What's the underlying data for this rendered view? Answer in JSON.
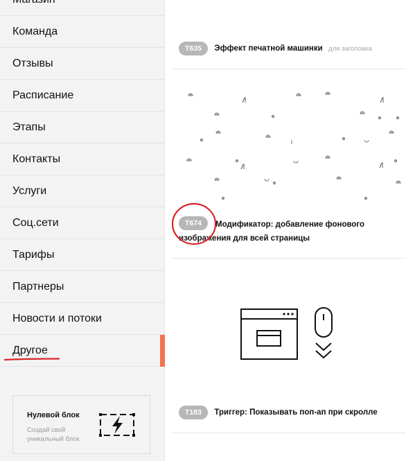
{
  "sidebar": {
    "top_partial_label": "Магазин",
    "items": [
      {
        "label": "Команда"
      },
      {
        "label": "Отзывы"
      },
      {
        "label": "Расписание"
      },
      {
        "label": "Этапы"
      },
      {
        "label": "Контакты"
      },
      {
        "label": "Услуги"
      },
      {
        "label": "Соц.сети"
      },
      {
        "label": "Тарифы"
      },
      {
        "label": "Партнеры"
      },
      {
        "label": "Новости и потоки"
      },
      {
        "label": "Другое",
        "active": true
      }
    ],
    "active_color": "#f4714e",
    "annotation_color": "#d9262a",
    "zero_block": {
      "title": "Нулевой блок",
      "subtitle": "Создай свой уникальный блок",
      "icon": "lightning-frame-icon"
    }
  },
  "cards": [
    {
      "code": "T635",
      "title": "Эффект печатной машинки",
      "hint": "для заголовка"
    },
    {
      "code": "T674",
      "title": "Модификатор: добавление фонового изображения для всей страницы",
      "preview": "pattern-preview"
    },
    {
      "code": "T183",
      "title": "Триггер: Показывать поп-ап при скролле",
      "preview": "popup-scroll-icon"
    }
  ]
}
